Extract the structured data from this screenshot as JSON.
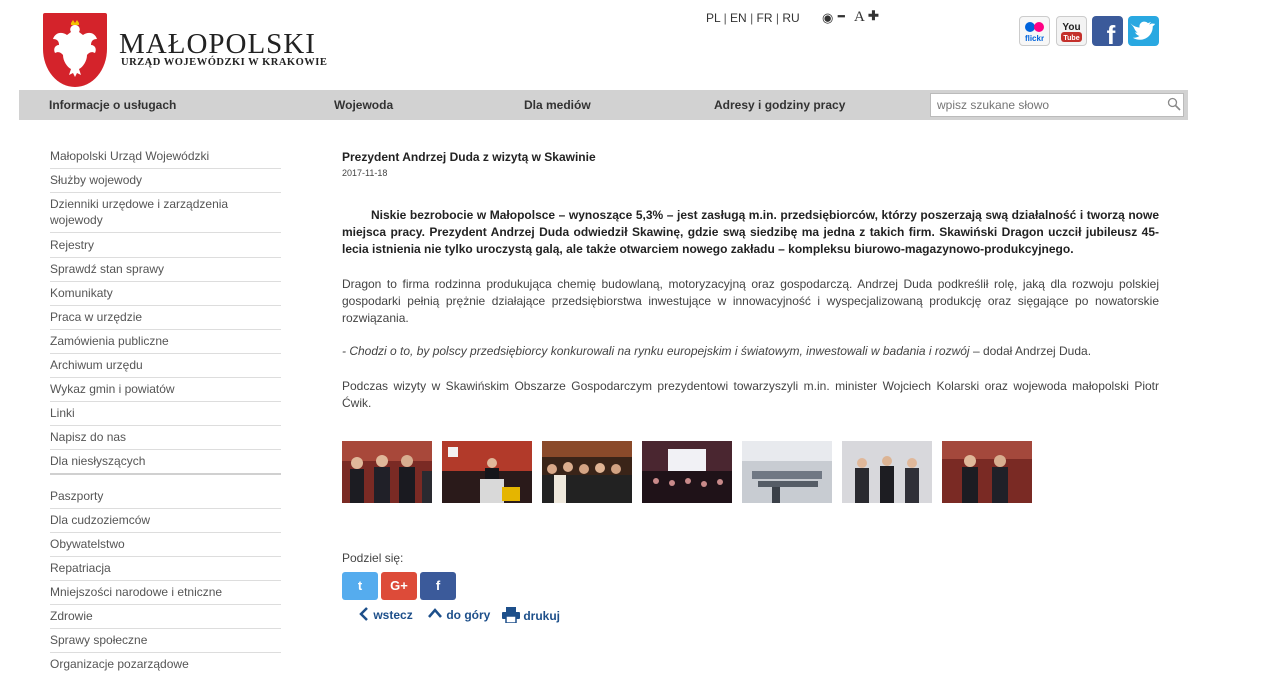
{
  "header": {
    "title": "MAŁOPOLSKI",
    "subtitle": "URZĄD WOJEWÓDZKI W KRAKOWIE",
    "languages": [
      "PL",
      "EN",
      "FR",
      "RU"
    ],
    "accessibility": {
      "contrast": "◉",
      "decrease": "━",
      "font": "A",
      "increase": "✚"
    },
    "social": [
      {
        "name": "flickr",
        "label": "flickr"
      },
      {
        "name": "youtube",
        "label": "You"
      },
      {
        "name": "facebook",
        "label": "f"
      },
      {
        "name": "twitter",
        "label": "t"
      }
    ]
  },
  "nav": {
    "items": [
      "Informacje o usługach",
      "Wojewoda",
      "Dla mediów",
      "Adresy i godziny pracy"
    ],
    "search_placeholder": "wpisz szukane słowo"
  },
  "sidebar": {
    "group1": [
      "Małopolski Urząd Wojewódzki",
      "Służby wojewody",
      "Dzienniki urzędowe i zarządzenia wojewody",
      "Rejestry",
      "Sprawdź stan sprawy",
      "Komunikaty",
      "Praca w urzędzie",
      "Zamówienia publiczne",
      "Archiwum urzędu",
      "Wykaz gmin i powiatów",
      "Linki",
      "Napisz do nas",
      "Dla niesłyszących"
    ],
    "group2": [
      "Paszporty",
      "Dla cudzoziemców",
      "Obywatelstwo",
      "Repatriacja",
      "Mniejszości narodowe i etniczne",
      "Zdrowie",
      "Sprawy społeczne",
      "Organizacje pozarządowe"
    ]
  },
  "article": {
    "title": "Prezydent Andrzej Duda z wizytą w Skawinie",
    "date": "2017-11-18",
    "lead": "Niskie bezrobocie w Małopolsce – wynoszące 5,3% – jest zasługą m.in. przedsiębiorców, którzy poszerzają swą działalność i tworzą nowe miejsca pracy. Prezydent Andrzej Duda odwiedził Skawinę, gdzie swą siedzibę ma jedna z takich firm. Skawiński Dragon uczcił jubileusz 45-lecia istnienia nie tylko uroczystą galą, ale także otwarciem nowego zakładu – kompleksu biurowo-magazynowo-produkcyjnego.",
    "p1": "Dragon to firma rodzinna produkująca chemię budowlaną, motoryzacyjną oraz gospodarczą. Andrzej Duda podkreślił rolę, jaką dla rozwoju polskiej gospodarki pełnią prężnie działające przedsiębiorstwa inwestujące w innowacyjność i wyspecjalizowaną produkcję oraz sięgające po nowatorskie rozwiązania.",
    "quote": "- Chodzi o to, by polscy przedsiębiorcy konkurowali na rynku europejskim i światowym, inwestowali w badania i rozwój",
    "quote_tail": " – dodał Andrzej Duda.",
    "p3": "Podczas wizyty w Skawińskim Obszarze Gospodarczym prezydentowi towarzyszyli m.in. minister Wojciech Kolarski oraz wojewoda małopolski Piotr Ćwik."
  },
  "share": {
    "label": "Podziel się:",
    "buttons": [
      "t",
      "G+",
      "f"
    ]
  },
  "links": {
    "back": "wstecz",
    "top": "do góry",
    "print": "drukuj"
  }
}
